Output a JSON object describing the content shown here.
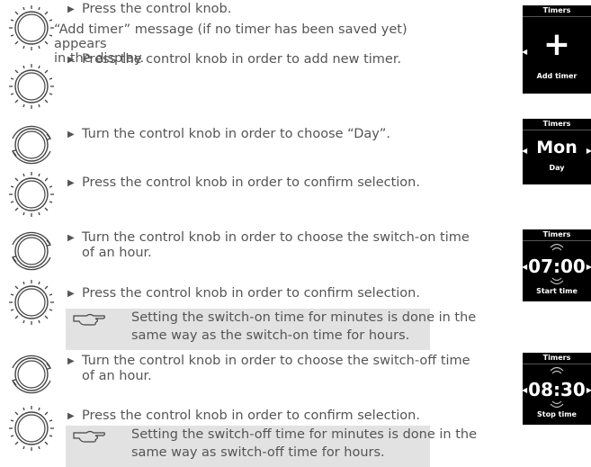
{
  "steps": {
    "s1": "Press the control knob.",
    "msg_line1": "“Add timer” message (if no timer has been saved yet) appears",
    "msg_line2": "in the display.",
    "s2": "Press the control knob in order to add new timer.",
    "s3": "Turn the control knob in order to choose “Day”.",
    "s4": "Press the control knob in order to confirm selection.",
    "s5_line1": "Turn the control knob in order to choose the switch-on time",
    "s5_line2": "of an hour.",
    "s6": "Press the control knob in order to confirm selection.",
    "s7_line1": "Turn the control knob in order to choose the switch-off time",
    "s7_line2": "of an hour.",
    "s8": "Press the control knob in order to confirm selection."
  },
  "notes": {
    "n1_line1": "Setting the switch-on time for minutes is done in the",
    "n1_line2": "same way as the switch-on time for hours.",
    "n2_line1": "Setting the switch-off time for minutes is done in the",
    "n2_line2": "same way as switch-off time for hours."
  },
  "screens": {
    "add": {
      "title": "Timers",
      "symbol": "+",
      "label": "Add timer"
    },
    "day": {
      "title": "Timers",
      "value": "Mon",
      "label": "Day"
    },
    "start": {
      "title": "Timers",
      "value": "07:00",
      "label": "Start time"
    },
    "stop": {
      "title": "Timers",
      "value": "08:30",
      "label": "Stop time"
    }
  },
  "colors": {
    "note_bg": "#e2e2e2",
    "screen_bg": "#000000",
    "text": "#555555"
  }
}
